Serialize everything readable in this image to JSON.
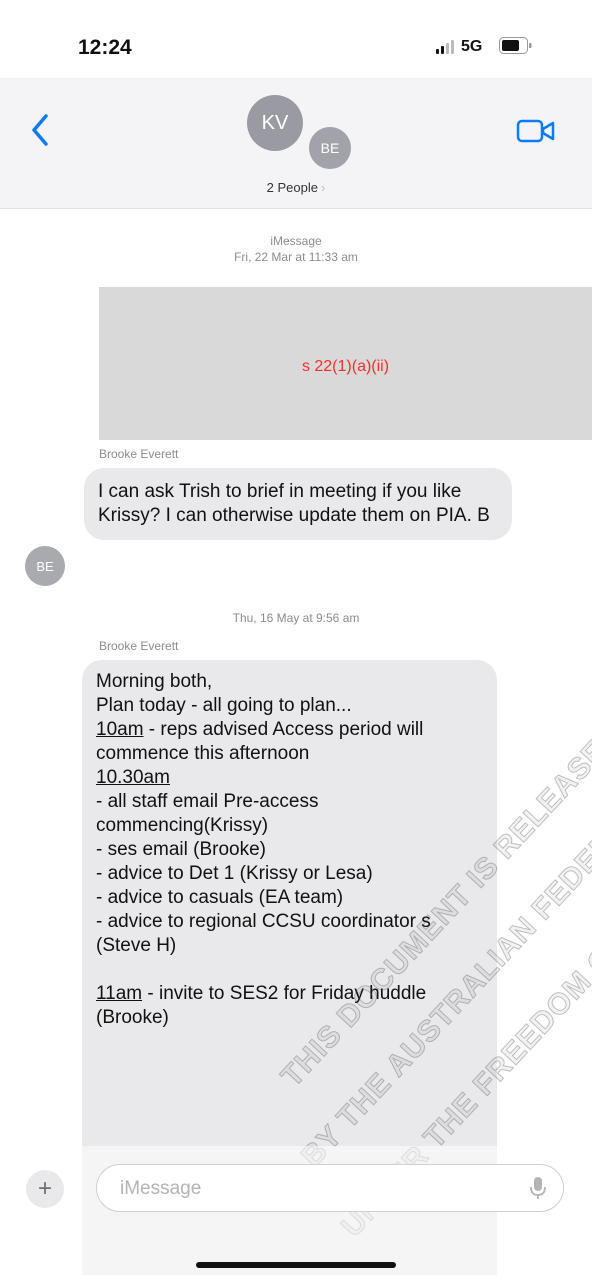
{
  "status_bar": {
    "time": "12:24",
    "network": "5G"
  },
  "header": {
    "avatars": [
      "KV",
      "BE"
    ],
    "subtitle": "2 People"
  },
  "thread": {
    "service_label": "iMessage",
    "first_timestamp": "Fri, 22 Mar at 11:33 am",
    "redaction_label": "s 22(1)(a)(ii)",
    "messages": [
      {
        "sender": "Brooke Everett",
        "avatar": "BE",
        "text": "I can ask Trish to brief in meeting if you like Krissy? I can otherwise update them on PIA. B"
      },
      {
        "timestamp": "Thu, 16 May at 9:56 am",
        "sender": "Brooke Everett",
        "lines": [
          {
            "text": "Morning both,"
          },
          {
            "text": "Plan today - all going to plan..."
          },
          {
            "time": "10am",
            "text": " - reps advised Access period will commence this afternoon"
          },
          {
            "time": "10.30am",
            "text": ""
          },
          {
            "text": "- all staff email Pre-access commencing(Krissy)"
          },
          {
            "text": "- ses email (Brooke)"
          },
          {
            "text": "- advice to Det 1 (Krissy or Lesa)"
          },
          {
            "text": "- advice to casuals (EA team)"
          },
          {
            "text": "- advice to regional CCSU coordinator s (Steve H)"
          },
          {
            "text": ""
          },
          {
            "time": "11am",
            "text": " - invite to SES2 for Friday huddle (Brooke)"
          }
        ]
      }
    ]
  },
  "composer": {
    "placeholder": "iMessage"
  },
  "watermark": [
    "THIS DOCUMENT IS RELEASED",
    "BY THE AUSTRALIAN FEDERAL",
    "UNDER THE FREEDOM OF"
  ]
}
